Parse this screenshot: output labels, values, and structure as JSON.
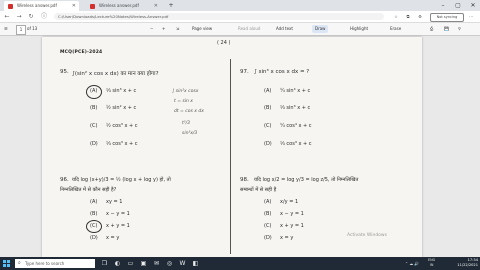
{
  "browser": {
    "tabs": [
      {
        "label": "Wireless answer.pdf",
        "active": true
      },
      {
        "label": "Wireless answer.pdf",
        "active": false
      }
    ],
    "url": "C:/User/Downloads/Lecture%20Notes/Wireless-Answer.pdf",
    "no_sync_label": "Not syncing"
  },
  "pdf_toolbar": {
    "page_current": "1",
    "page_total": "of 13",
    "page_view": "Page view",
    "read_aloud": "Read aloud",
    "add_text": "Add text",
    "draw": "Draw",
    "highlight": "Highlight",
    "erase": "Erase"
  },
  "document": {
    "page_number": "( 24 )",
    "header": "MCQ(PCE)-2024",
    "left": {
      "q_number": "95.",
      "q_text": "∫(sin² x cos x dx) का मान क्या होगा?",
      "options": [
        {
          "key": "(A)",
          "text": "⅓ sin³ x + c"
        },
        {
          "key": "(B)",
          "text": "½ sin² x + c"
        },
        {
          "key": "(C)",
          "text": "½ cos³ x + c"
        },
        {
          "key": "(D)",
          "text": "⅓ cos³ x + c"
        }
      ],
      "q2_number": "96.",
      "q2_text": "यदि log (x+y)/3 = ½ (log x + log y) हो, तो",
      "q2_line2": "निम्नलिखित में से कौन सही है?",
      "q2_options": [
        {
          "key": "(A)",
          "text": "xy = 1"
        },
        {
          "key": "(B)",
          "text": "x − y = 1"
        },
        {
          "key": "(C)",
          "text": "x + y = 1"
        },
        {
          "key": "(D)",
          "text": "x = y"
        }
      ]
    },
    "right": {
      "q_number": "97.",
      "q_text": "∫ sin³ x cos x dx = ?",
      "options": [
        {
          "key": "(A)",
          "text": "¼ sin⁴ x + c"
        },
        {
          "key": "(B)",
          "text": "⅓ sin³ x + c"
        },
        {
          "key": "(C)",
          "text": "¼ cos⁴ x + c"
        },
        {
          "key": "(D)",
          "text": "⅓ cos³ x + c"
        }
      ],
      "q2_number": "98.",
      "q2_text": "यदि log x/2 = log y/3 = log z/5, तो निम्नलिखित",
      "q2_line2": "सम्बन्धों में से सही है",
      "q2_options": [
        {
          "key": "(A)",
          "text": "x/y = 1"
        },
        {
          "key": "(B)",
          "text": "x − y = 1"
        },
        {
          "key": "(C)",
          "text": "x + y = 1"
        },
        {
          "key": "(D)",
          "text": "x = y"
        }
      ]
    },
    "annotations": [
      "∫ sin²x cosx",
      "t = sin x",
      "dt = cos x dx",
      "t³/3",
      "sin³x/3"
    ],
    "watermark": "Activate Windows"
  },
  "taskbar": {
    "search_placeholder": "Type here to search",
    "tray_lang": "ENG",
    "tray_region": "IN",
    "time": "17:34",
    "date": "11/22/2021"
  }
}
